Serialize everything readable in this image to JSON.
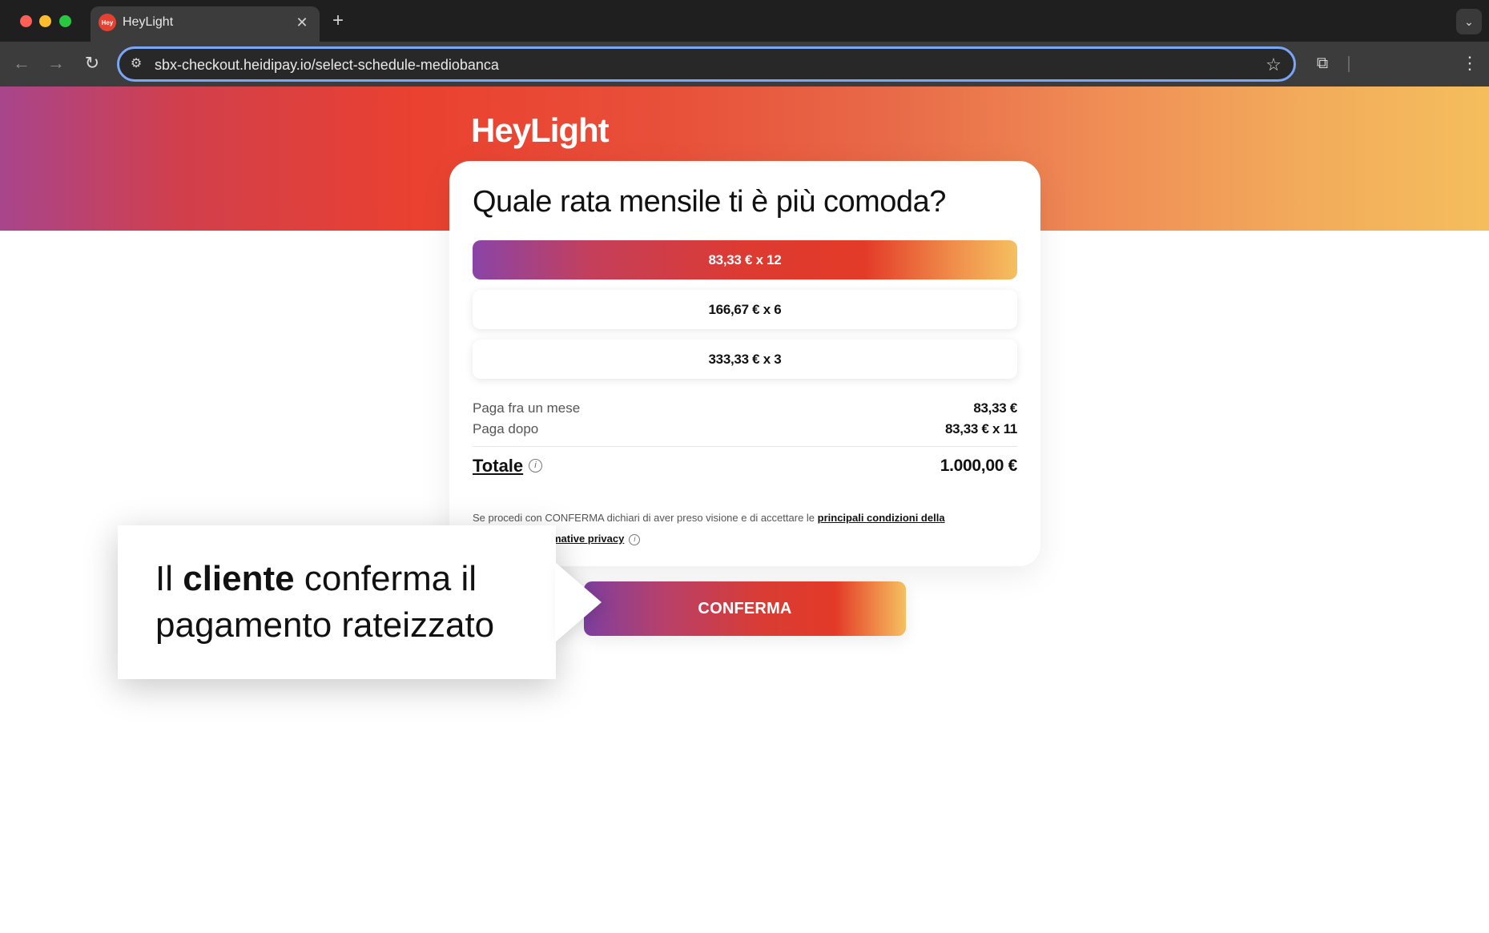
{
  "browser": {
    "tab_title": "HeyLight",
    "tab_favicon_text": "Hey",
    "url": "sbx-checkout.heidipay.io/select-schedule-mediobanca"
  },
  "brand": {
    "logo": "HeyLight",
    "colors": {
      "red": "#e64130",
      "purple": "#8a44a8",
      "orange": "#f5be5c"
    }
  },
  "card": {
    "title": "Quale rata mensile ti è più comoda?",
    "options": [
      {
        "label": "83,33 € x 12",
        "selected": true
      },
      {
        "label": "166,67 € x 6",
        "selected": false
      },
      {
        "label": "333,33 € x 3",
        "selected": false
      }
    ],
    "summary": {
      "pay_in_month_label": "Paga fra un mese",
      "pay_in_month_value": "83,33 €",
      "pay_later_label": "Paga dopo",
      "pay_later_value": "83,33 € x 11",
      "total_label": "Totale",
      "total_value": "1.000,00 €"
    },
    "legal": {
      "text": "Se procedi con CONFERMA dichiari di aver preso visione e di accettare le ",
      "link1": "principali condizioni della",
      "text2": "ormative privacy"
    }
  },
  "confirm_label": "CONFERMA",
  "callout": {
    "pre": "Il ",
    "bold": "cliente",
    "post": " conferma il pagamento rateizzato"
  }
}
